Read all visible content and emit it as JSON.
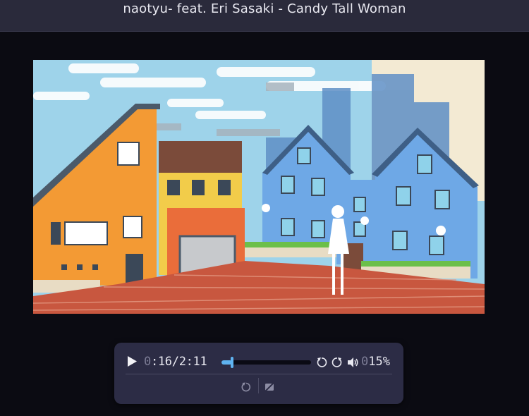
{
  "window": {
    "title": "naotyu- feat. Eri Sasaki - Candy Tall Woman"
  },
  "player": {
    "time_current_dim": "0",
    "time_current": ":16",
    "time_separator": "/",
    "time_total": "2:11",
    "progress_fraction": 0.122,
    "volume_dim": "0",
    "volume": "15%",
    "icons": [
      "play-icon",
      "rewind-icon",
      "replay-icon",
      "volume-icon",
      "loop-icon",
      "no-captions-icon"
    ]
  },
  "colors": {
    "accent": "#5fb3f0",
    "panel": "#2c2c45",
    "titlebar": "#2a2a3b"
  }
}
